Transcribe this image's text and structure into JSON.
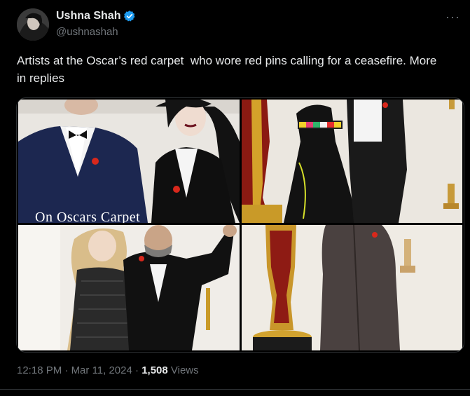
{
  "user": {
    "display_name": "Ushna Shah",
    "handle": "@ushnashah"
  },
  "tweet": {
    "text": "Artists at the Oscar’s red carpet  who wore red pins calling for a ceasefire. More in replies"
  },
  "media": {
    "caption": "On Oscars Carpet"
  },
  "meta": {
    "time": "12:18 PM",
    "sep1": " · ",
    "date": "Mar 11, 2024",
    "sep2": " · ",
    "views_count": "1,508",
    "views_label": " Views"
  },
  "colors": {
    "accent": "#1d9bf0",
    "pin_red": "#d8281c"
  }
}
